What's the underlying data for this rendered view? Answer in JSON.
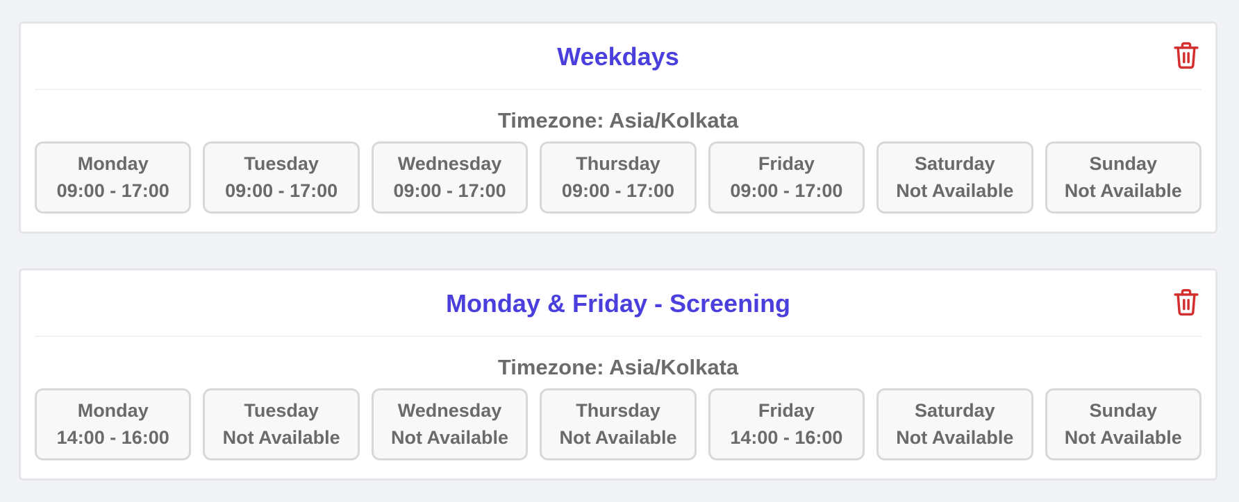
{
  "schedules": [
    {
      "title": "Weekdays",
      "timezone": "Timezone: Asia/Kolkata",
      "days": [
        {
          "name": "Monday",
          "hours": "09:00 - 17:00"
        },
        {
          "name": "Tuesday",
          "hours": "09:00 - 17:00"
        },
        {
          "name": "Wednesday",
          "hours": "09:00 - 17:00"
        },
        {
          "name": "Thursday",
          "hours": "09:00 - 17:00"
        },
        {
          "name": "Friday",
          "hours": "09:00 - 17:00"
        },
        {
          "name": "Saturday",
          "hours": "Not Available"
        },
        {
          "name": "Sunday",
          "hours": "Not Available"
        }
      ]
    },
    {
      "title": "Monday & Friday - Screening",
      "timezone": "Timezone: Asia/Kolkata",
      "days": [
        {
          "name": "Monday",
          "hours": "14:00 - 16:00"
        },
        {
          "name": "Tuesday",
          "hours": "Not Available"
        },
        {
          "name": "Wednesday",
          "hours": "Not Available"
        },
        {
          "name": "Thursday",
          "hours": "Not Available"
        },
        {
          "name": "Friday",
          "hours": "14:00 - 16:00"
        },
        {
          "name": "Saturday",
          "hours": "Not Available"
        },
        {
          "name": "Sunday",
          "hours": "Not Available"
        }
      ]
    }
  ],
  "icons": {
    "delete": "trash-icon"
  },
  "colors": {
    "title": "#4a3fdc",
    "delete": "#d32f2f",
    "text": "#6a6a6a",
    "background": "#f2f3f5"
  }
}
